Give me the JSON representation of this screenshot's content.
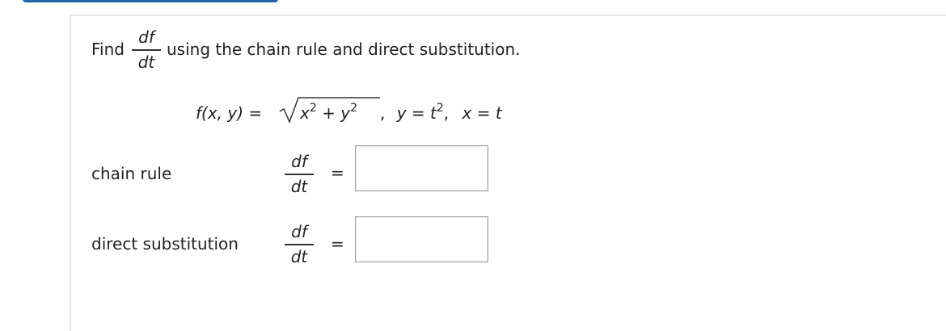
{
  "prompt": {
    "find_label": "Find",
    "frac_num": "df",
    "frac_den": "dt",
    "rest": "using the chain rule and direct substitution."
  },
  "equation": {
    "lhs": "f(x, y) = ",
    "radicand_x": "x",
    "exp_x": "2",
    "plus": " + ",
    "radicand_y": "y",
    "exp_y": "2",
    "comma1": ",",
    "y_eq": "y = t",
    "exp_t": "2",
    "comma2": ",",
    "x_eq": "x = t"
  },
  "rows": [
    {
      "label": "chain rule",
      "frac_num": "df",
      "frac_den": "dt",
      "equals": "=",
      "answer": ""
    },
    {
      "label": "direct substitution",
      "frac_num": "df",
      "frac_den": "dt",
      "equals": "=",
      "answer": ""
    }
  ],
  "colors": {
    "accent": "#2266a8",
    "border": "#9a9a9a",
    "rule": "#e6e6e6",
    "text": "#222222"
  }
}
